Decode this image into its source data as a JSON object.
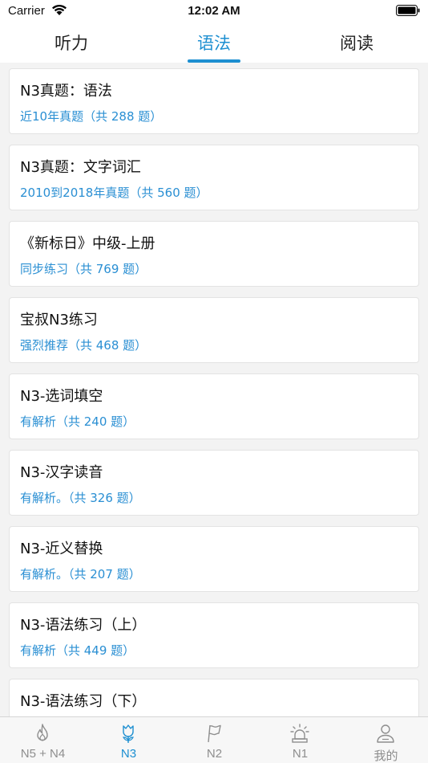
{
  "status_bar": {
    "carrier": "Carrier",
    "time": "12:02 AM",
    "wifi_icon": "wifi-icon",
    "battery_icon": "battery-icon"
  },
  "segments": [
    {
      "label": "听力",
      "active": false
    },
    {
      "label": "语法",
      "active": true
    },
    {
      "label": "阅读",
      "active": false
    }
  ],
  "items": [
    {
      "title": "N3真题：语法",
      "subtitle": "近10年真题（共 288 题）"
    },
    {
      "title": "N3真题：文字词汇",
      "subtitle": "2010到2018年真题（共 560 题）"
    },
    {
      "title": "《新标日》中级-上册",
      "subtitle": "同步练习（共 769 题）"
    },
    {
      "title": "宝叔N3练习",
      "subtitle": "强烈推荐（共 468 题）"
    },
    {
      "title": "N3-选词填空",
      "subtitle": "有解析（共 240 题）"
    },
    {
      "title": "N3-汉字读音",
      "subtitle": "有解析。（共 326 题）"
    },
    {
      "title": "N3-近义替换",
      "subtitle": "有解析。（共 207 题）"
    },
    {
      "title": "N3-语法练习（上）",
      "subtitle": "有解析（共 449 题）"
    },
    {
      "title": "N3-语法练习（下）",
      "subtitle": ""
    }
  ],
  "tabbar": [
    {
      "label": "N5 + N4",
      "icon": "flame-icon",
      "active": false
    },
    {
      "label": "N3",
      "icon": "tulip-icon",
      "active": true
    },
    {
      "label": "N2",
      "icon": "flag-icon",
      "active": false
    },
    {
      "label": "N1",
      "icon": "alarm-light-icon",
      "active": false
    },
    {
      "label": "我的",
      "icon": "person-icon",
      "active": false
    }
  ],
  "colors": {
    "accent": "#1d8fd1",
    "subtitle": "#2a8fd3",
    "inactive_tab": "#8e8e8e",
    "background": "#f3f3f3"
  }
}
